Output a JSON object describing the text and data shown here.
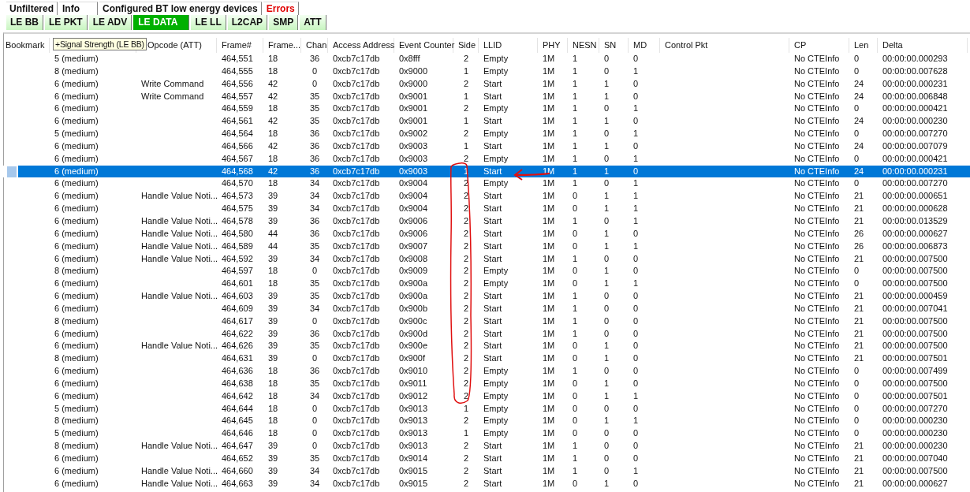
{
  "tabs_top": [
    {
      "label": "Unfiltered",
      "selected": false,
      "kind": "normal"
    },
    {
      "label": "Info",
      "selected": false,
      "kind": "normal"
    },
    {
      "label": "Configured BT low energy devices",
      "selected": false,
      "kind": "normal"
    },
    {
      "label": "Errors",
      "selected": false,
      "kind": "error"
    }
  ],
  "tabs_protocol": [
    {
      "label": "LE BB",
      "selected": false
    },
    {
      "label": "LE PKT",
      "selected": false
    },
    {
      "label": "LE ADV",
      "selected": false
    },
    {
      "label": "LE DATA",
      "selected": true
    },
    {
      "label": "LE LL",
      "selected": false
    },
    {
      "label": "L2CAP",
      "selected": false
    },
    {
      "label": "SMP",
      "selected": false
    },
    {
      "label": "ATT",
      "selected": false
    }
  ],
  "tooltip": "+Signal Strength (LE BB)",
  "table": {
    "columns": [
      "Bookmark",
      "Opcode (ATT)",
      "Frame#",
      "Frame...",
      "Chan",
      "Access Address",
      "Event Counter",
      "Side",
      "LLID",
      "PHY",
      "NESN",
      "SN",
      "MD",
      "Control Pkt",
      "CP",
      "Len",
      "Delta"
    ],
    "rows": [
      {
        "selected": false,
        "signal": "5 (medium)",
        "frame": "464,551",
        "frame_len": "18",
        "chan": "36",
        "access_address": "0xcb7c17db",
        "event_counter": "0x8fff",
        "side": "2",
        "llid": "Empty",
        "phy": "1M",
        "nesn": "1",
        "sn": "0",
        "md": "0",
        "cp": "No CTEInfo",
        "len": "0",
        "delta": "00:00:00.000293"
      },
      {
        "selected": false,
        "signal": "8 (medium)",
        "frame": "464,555",
        "frame_len": "18",
        "chan": "0",
        "access_address": "0xcb7c17db",
        "event_counter": "0x9000",
        "side": "1",
        "llid": "Empty",
        "phy": "1M",
        "nesn": "1",
        "sn": "0",
        "md": "1",
        "cp": "No CTEInfo",
        "len": "0",
        "delta": "00:00:00.007628"
      },
      {
        "selected": false,
        "signal": "6 (medium)",
        "opcode": "Write Command",
        "frame": "464,556",
        "frame_len": "42",
        "chan": "0",
        "access_address": "0xcb7c17db",
        "event_counter": "0x9000",
        "side": "2",
        "llid": "Start",
        "phy": "1M",
        "nesn": "1",
        "sn": "1",
        "md": "0",
        "cp": "No CTEInfo",
        "len": "24",
        "delta": "00:00:00.000231"
      },
      {
        "selected": false,
        "signal": "6 (medium)",
        "opcode": "Write Command",
        "frame": "464,557",
        "frame_len": "42",
        "chan": "35",
        "access_address": "0xcb7c17db",
        "event_counter": "0x9001",
        "side": "1",
        "llid": "Start",
        "phy": "1M",
        "nesn": "1",
        "sn": "1",
        "md": "0",
        "cp": "No CTEInfo",
        "len": "24",
        "delta": "00:00:00.006848"
      },
      {
        "selected": false,
        "signal": "6 (medium)",
        "frame": "464,559",
        "frame_len": "18",
        "chan": "35",
        "access_address": "0xcb7c17db",
        "event_counter": "0x9001",
        "side": "2",
        "llid": "Empty",
        "phy": "1M",
        "nesn": "1",
        "sn": "0",
        "md": "1",
        "cp": "No CTEInfo",
        "len": "0",
        "delta": "00:00:00.000421"
      },
      {
        "selected": false,
        "signal": "6 (medium)",
        "frame": "464,561",
        "frame_len": "42",
        "chan": "35",
        "access_address": "0xcb7c17db",
        "event_counter": "0x9001",
        "side": "1",
        "llid": "Start",
        "phy": "1M",
        "nesn": "1",
        "sn": "1",
        "md": "0",
        "cp": "No CTEInfo",
        "len": "24",
        "delta": "00:00:00.000230"
      },
      {
        "selected": false,
        "signal": "5 (medium)",
        "frame": "464,564",
        "frame_len": "18",
        "chan": "36",
        "access_address": "0xcb7c17db",
        "event_counter": "0x9002",
        "side": "2",
        "llid": "Empty",
        "phy": "1M",
        "nesn": "1",
        "sn": "0",
        "md": "1",
        "cp": "No CTEInfo",
        "len": "0",
        "delta": "00:00:00.007270"
      },
      {
        "selected": false,
        "signal": "6 (medium)",
        "frame": "464,566",
        "frame_len": "42",
        "chan": "36",
        "access_address": "0xcb7c17db",
        "event_counter": "0x9003",
        "side": "1",
        "llid": "Start",
        "phy": "1M",
        "nesn": "1",
        "sn": "1",
        "md": "0",
        "cp": "No CTEInfo",
        "len": "24",
        "delta": "00:00:00.007079"
      },
      {
        "selected": false,
        "signal": "6 (medium)",
        "frame": "464,567",
        "frame_len": "18",
        "chan": "36",
        "access_address": "0xcb7c17db",
        "event_counter": "0x9003",
        "side": "2",
        "llid": "Empty",
        "phy": "1M",
        "nesn": "1",
        "sn": "0",
        "md": "1",
        "cp": "No CTEInfo",
        "len": "0",
        "delta": "00:00:00.000421"
      },
      {
        "selected": true,
        "signal": "6 (medium)",
        "frame": "464,568",
        "frame_len": "42",
        "chan": "36",
        "access_address": "0xcb7c17db",
        "event_counter": "0x9003",
        "side": "1",
        "llid": "Start",
        "phy": "1M",
        "nesn": "1",
        "sn": "1",
        "md": "0",
        "cp": "No CTEInfo",
        "len": "24",
        "delta": "00:00:00.000231"
      },
      {
        "selected": false,
        "signal": "6 (medium)",
        "frame": "464,570",
        "frame_len": "18",
        "chan": "34",
        "access_address": "0xcb7c17db",
        "event_counter": "0x9004",
        "side": "2",
        "llid": "Empty",
        "phy": "1M",
        "nesn": "1",
        "sn": "0",
        "md": "1",
        "cp": "No CTEInfo",
        "len": "0",
        "delta": "00:00:00.007270"
      },
      {
        "selected": false,
        "signal": "6 (medium)",
        "opcode": "Handle Value Noti...",
        "frame": "464,573",
        "frame_len": "39",
        "chan": "34",
        "access_address": "0xcb7c17db",
        "event_counter": "0x9004",
        "side": "2",
        "llid": "Start",
        "phy": "1M",
        "nesn": "0",
        "sn": "1",
        "md": "1",
        "cp": "No CTEInfo",
        "len": "21",
        "delta": "00:00:00.000651"
      },
      {
        "selected": false,
        "signal": "6 (medium)",
        "frame": "464,575",
        "frame_len": "39",
        "chan": "34",
        "access_address": "0xcb7c17db",
        "event_counter": "0x9004",
        "side": "2",
        "llid": "Start",
        "phy": "1M",
        "nesn": "0",
        "sn": "1",
        "md": "1",
        "cp": "No CTEInfo",
        "len": "21",
        "delta": "00:00:00.000628"
      },
      {
        "selected": false,
        "signal": "6 (medium)",
        "opcode": "Handle Value Noti...",
        "frame": "464,578",
        "frame_len": "39",
        "chan": "36",
        "access_address": "0xcb7c17db",
        "event_counter": "0x9006",
        "side": "2",
        "llid": "Start",
        "phy": "1M",
        "nesn": "1",
        "sn": "0",
        "md": "1",
        "cp": "No CTEInfo",
        "len": "21",
        "delta": "00:00:00.013529"
      },
      {
        "selected": false,
        "signal": "6 (medium)",
        "opcode": "Handle Value Noti...",
        "frame": "464,580",
        "frame_len": "44",
        "chan": "36",
        "access_address": "0xcb7c17db",
        "event_counter": "0x9006",
        "side": "2",
        "llid": "Start",
        "phy": "1M",
        "nesn": "0",
        "sn": "1",
        "md": "0",
        "cp": "No CTEInfo",
        "len": "26",
        "delta": "00:00:00.000627"
      },
      {
        "selected": false,
        "signal": "6 (medium)",
        "opcode": "Handle Value Noti...",
        "frame": "464,589",
        "frame_len": "44",
        "chan": "35",
        "access_address": "0xcb7c17db",
        "event_counter": "0x9007",
        "side": "2",
        "llid": "Start",
        "phy": "1M",
        "nesn": "0",
        "sn": "1",
        "md": "1",
        "cp": "No CTEInfo",
        "len": "26",
        "delta": "00:00:00.006873"
      },
      {
        "selected": false,
        "signal": "6 (medium)",
        "opcode": "Handle Value Noti...",
        "frame": "464,592",
        "frame_len": "39",
        "chan": "34",
        "access_address": "0xcb7c17db",
        "event_counter": "0x9008",
        "side": "2",
        "llid": "Start",
        "phy": "1M",
        "nesn": "1",
        "sn": "0",
        "md": "0",
        "cp": "No CTEInfo",
        "len": "21",
        "delta": "00:00:00.007500"
      },
      {
        "selected": false,
        "signal": "8 (medium)",
        "frame": "464,597",
        "frame_len": "18",
        "chan": "0",
        "access_address": "0xcb7c17db",
        "event_counter": "0x9009",
        "side": "2",
        "llid": "Empty",
        "phy": "1M",
        "nesn": "0",
        "sn": "1",
        "md": "0",
        "cp": "No CTEInfo",
        "len": "0",
        "delta": "00:00:00.007500"
      },
      {
        "selected": false,
        "signal": "6 (medium)",
        "frame": "464,601",
        "frame_len": "18",
        "chan": "35",
        "access_address": "0xcb7c17db",
        "event_counter": "0x900a",
        "side": "2",
        "llid": "Empty",
        "phy": "1M",
        "nesn": "0",
        "sn": "1",
        "md": "1",
        "cp": "No CTEInfo",
        "len": "0",
        "delta": "00:00:00.007500"
      },
      {
        "selected": false,
        "signal": "6 (medium)",
        "opcode": "Handle Value Noti...",
        "frame": "464,603",
        "frame_len": "39",
        "chan": "35",
        "access_address": "0xcb7c17db",
        "event_counter": "0x900a",
        "side": "2",
        "llid": "Start",
        "phy": "1M",
        "nesn": "1",
        "sn": "0",
        "md": "0",
        "cp": "No CTEInfo",
        "len": "21",
        "delta": "00:00:00.000459"
      },
      {
        "selected": false,
        "signal": "6 (medium)",
        "frame": "464,609",
        "frame_len": "39",
        "chan": "34",
        "access_address": "0xcb7c17db",
        "event_counter": "0x900b",
        "side": "2",
        "llid": "Start",
        "phy": "1M",
        "nesn": "1",
        "sn": "0",
        "md": "0",
        "cp": "No CTEInfo",
        "len": "21",
        "delta": "00:00:00.007041"
      },
      {
        "selected": false,
        "signal": "8 (medium)",
        "frame": "464,617",
        "frame_len": "39",
        "chan": "0",
        "access_address": "0xcb7c17db",
        "event_counter": "0x900c",
        "side": "2",
        "llid": "Start",
        "phy": "1M",
        "nesn": "1",
        "sn": "0",
        "md": "0",
        "cp": "No CTEInfo",
        "len": "21",
        "delta": "00:00:00.007500"
      },
      {
        "selected": false,
        "signal": "6 (medium)",
        "frame": "464,622",
        "frame_len": "39",
        "chan": "36",
        "access_address": "0xcb7c17db",
        "event_counter": "0x900d",
        "side": "2",
        "llid": "Start",
        "phy": "1M",
        "nesn": "1",
        "sn": "0",
        "md": "0",
        "cp": "No CTEInfo",
        "len": "21",
        "delta": "00:00:00.007500"
      },
      {
        "selected": false,
        "signal": "6 (medium)",
        "opcode": "Handle Value Noti...",
        "frame": "464,626",
        "frame_len": "39",
        "chan": "35",
        "access_address": "0xcb7c17db",
        "event_counter": "0x900e",
        "side": "2",
        "llid": "Start",
        "phy": "1M",
        "nesn": "0",
        "sn": "1",
        "md": "0",
        "cp": "No CTEInfo",
        "len": "21",
        "delta": "00:00:00.007500"
      },
      {
        "selected": false,
        "signal": "8 (medium)",
        "frame": "464,631",
        "frame_len": "39",
        "chan": "0",
        "access_address": "0xcb7c17db",
        "event_counter": "0x900f",
        "side": "2",
        "llid": "Start",
        "phy": "1M",
        "nesn": "0",
        "sn": "1",
        "md": "0",
        "cp": "No CTEInfo",
        "len": "21",
        "delta": "00:00:00.007501"
      },
      {
        "selected": false,
        "signal": "6 (medium)",
        "frame": "464,636",
        "frame_len": "18",
        "chan": "36",
        "access_address": "0xcb7c17db",
        "event_counter": "0x9010",
        "side": "2",
        "llid": "Empty",
        "phy": "1M",
        "nesn": "1",
        "sn": "0",
        "md": "0",
        "cp": "No CTEInfo",
        "len": "0",
        "delta": "00:00:00.007499"
      },
      {
        "selected": false,
        "signal": "6 (medium)",
        "frame": "464,638",
        "frame_len": "18",
        "chan": "35",
        "access_address": "0xcb7c17db",
        "event_counter": "0x9011",
        "side": "2",
        "llid": "Empty",
        "phy": "1M",
        "nesn": "0",
        "sn": "1",
        "md": "0",
        "cp": "No CTEInfo",
        "len": "0",
        "delta": "00:00:00.007500"
      },
      {
        "selected": false,
        "signal": "6 (medium)",
        "frame": "464,642",
        "frame_len": "18",
        "chan": "34",
        "access_address": "0xcb7c17db",
        "event_counter": "0x9012",
        "side": "2",
        "llid": "Empty",
        "phy": "1M",
        "nesn": "0",
        "sn": "1",
        "md": "1",
        "cp": "No CTEInfo",
        "len": "0",
        "delta": "00:00:00.007501"
      },
      {
        "selected": false,
        "signal": "5 (medium)",
        "frame": "464,644",
        "frame_len": "18",
        "chan": "0",
        "access_address": "0xcb7c17db",
        "event_counter": "0x9013",
        "side": "1",
        "llid": "Empty",
        "phy": "1M",
        "nesn": "0",
        "sn": "0",
        "md": "0",
        "cp": "No CTEInfo",
        "len": "0",
        "delta": "00:00:00.007270"
      },
      {
        "selected": false,
        "signal": "8 (medium)",
        "frame": "464,645",
        "frame_len": "18",
        "chan": "0",
        "access_address": "0xcb7c17db",
        "event_counter": "0x9013",
        "side": "2",
        "llid": "Empty",
        "phy": "1M",
        "nesn": "0",
        "sn": "1",
        "md": "1",
        "cp": "No CTEInfo",
        "len": "0",
        "delta": "00:00:00.000230"
      },
      {
        "selected": false,
        "signal": "5 (medium)",
        "frame": "464,646",
        "frame_len": "18",
        "chan": "0",
        "access_address": "0xcb7c17db",
        "event_counter": "0x9013",
        "side": "1",
        "llid": "Empty",
        "phy": "1M",
        "nesn": "0",
        "sn": "0",
        "md": "0",
        "cp": "No CTEInfo",
        "len": "0",
        "delta": "00:00:00.000230"
      },
      {
        "selected": false,
        "signal": "8 (medium)",
        "opcode": "Handle Value Noti...",
        "frame": "464,647",
        "frame_len": "39",
        "chan": "0",
        "access_address": "0xcb7c17db",
        "event_counter": "0x9013",
        "side": "2",
        "llid": "Start",
        "phy": "1M",
        "nesn": "1",
        "sn": "0",
        "md": "0",
        "cp": "No CTEInfo",
        "len": "21",
        "delta": "00:00:00.000230"
      },
      {
        "selected": false,
        "signal": "6 (medium)",
        "frame": "464,652",
        "frame_len": "39",
        "chan": "35",
        "access_address": "0xcb7c17db",
        "event_counter": "0x9014",
        "side": "2",
        "llid": "Start",
        "phy": "1M",
        "nesn": "1",
        "sn": "0",
        "md": "0",
        "cp": "No CTEInfo",
        "len": "21",
        "delta": "00:00:00.007040"
      },
      {
        "selected": false,
        "signal": "6 (medium)",
        "opcode": "Handle Value Noti...",
        "frame": "464,660",
        "frame_len": "39",
        "chan": "34",
        "access_address": "0xcb7c17db",
        "event_counter": "0x9015",
        "side": "2",
        "llid": "Start",
        "phy": "1M",
        "nesn": "1",
        "sn": "0",
        "md": "1",
        "cp": "No CTEInfo",
        "len": "21",
        "delta": "00:00:00.007500"
      },
      {
        "selected": false,
        "signal": "6 (medium)",
        "opcode": "Handle Value Noti...",
        "frame": "464,663",
        "frame_len": "39",
        "chan": "34",
        "access_address": "0xcb7c17db",
        "event_counter": "0x9015",
        "side": "2",
        "llid": "Start",
        "phy": "1M",
        "nesn": "0",
        "sn": "1",
        "md": "0",
        "cp": "No CTEInfo",
        "len": "21",
        "delta": "00:00:00.000627"
      }
    ]
  }
}
